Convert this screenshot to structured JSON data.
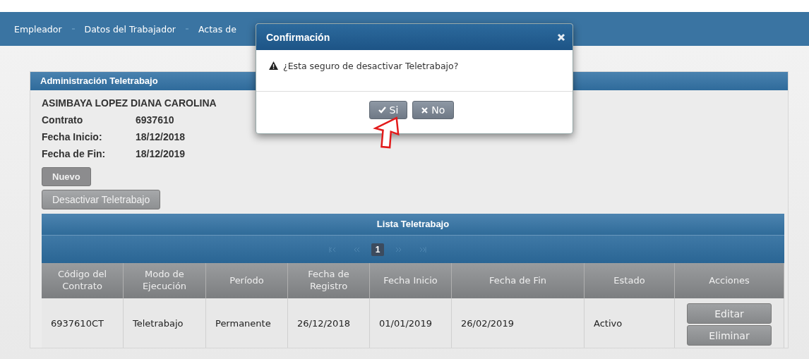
{
  "nav": {
    "items": [
      "Empleador",
      "Datos del Trabajador",
      "Actas de"
    ]
  },
  "panel": {
    "title": "Administración Teletrabajo",
    "employee": "ASIMBAYA LOPEZ DIANA CAROLINA",
    "fields": [
      {
        "label": "Contrato",
        "value": "6937610"
      },
      {
        "label": "Fecha Inicio:",
        "value": "18/12/2018"
      },
      {
        "label": "Fecha de Fin:",
        "value": "18/12/2019"
      }
    ],
    "buttons": [
      "Nuevo",
      "Desactivar Teletrabajo"
    ]
  },
  "table": {
    "title": "Lista Teletrabajo",
    "pager": [
      {
        "kind": "first"
      },
      {
        "kind": "prev"
      },
      {
        "kind": "page",
        "label": "1",
        "selected": true
      },
      {
        "kind": "next"
      },
      {
        "kind": "last"
      }
    ],
    "columns": [
      "Código del Contrato",
      "Modo de Ejecución",
      "Período",
      "Fecha de Registro",
      "Fecha Inicio",
      "Fecha de Fin",
      "Estado",
      "Acciones"
    ],
    "rows": [
      {
        "cells": [
          "6937610CT",
          "Teletrabajo",
          "Permanente",
          "26/12/2018",
          "01/01/2019",
          "26/02/2019",
          "Activo"
        ],
        "actions": [
          "Editar",
          "Eliminar"
        ]
      }
    ]
  },
  "dialog": {
    "title": "Confirmación",
    "message": "¿Esta seguro de desactivar Teletrabajo?",
    "buttons": [
      {
        "kind": "yes",
        "label": "Si"
      },
      {
        "kind": "no",
        "label": "No"
      }
    ]
  }
}
